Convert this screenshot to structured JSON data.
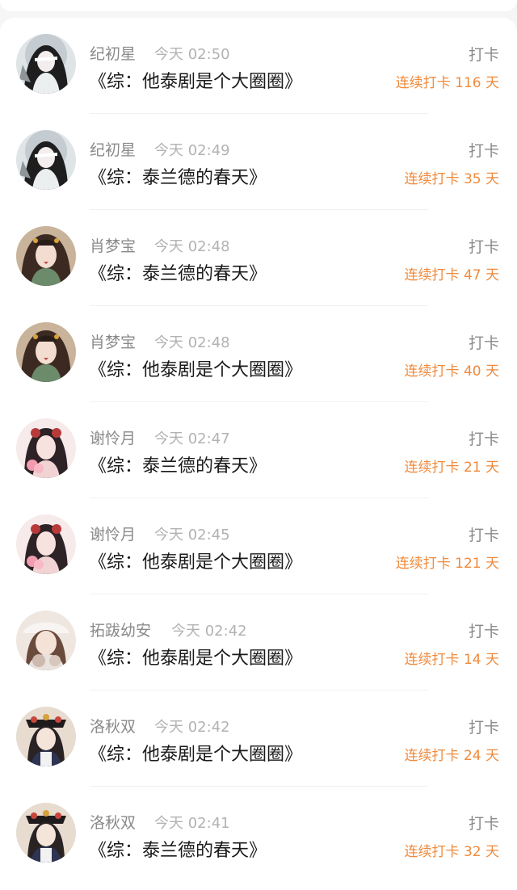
{
  "checkins": [
    {
      "user": "纪初星",
      "time": "今天 02:50",
      "book": "《综：他泰剧是个大圈圈》",
      "action": "打卡",
      "streak": "连续打卡 116 天",
      "avatar": "avatar-ghost-girl"
    },
    {
      "user": "纪初星",
      "time": "今天 02:49",
      "book": "《综：泰兰德的春天》",
      "action": "打卡",
      "streak": "连续打卡 35 天",
      "avatar": "avatar-ghost-girl"
    },
    {
      "user": "肖梦宝",
      "time": "今天 02:48",
      "book": "《综：泰兰德的春天》",
      "action": "打卡",
      "streak": "连续打卡 47 天",
      "avatar": "avatar-ancient-lady"
    },
    {
      "user": "肖梦宝",
      "time": "今天 02:48",
      "book": "《综：他泰剧是个大圈圈》",
      "action": "打卡",
      "streak": "连续打卡 40 天",
      "avatar": "avatar-ancient-lady"
    },
    {
      "user": "谢怜月",
      "time": "今天 02:47",
      "book": "《综：泰兰德的春天》",
      "action": "打卡",
      "streak": "连续打卡 21 天",
      "avatar": "avatar-pink-lady"
    },
    {
      "user": "谢怜月",
      "time": "今天 02:45",
      "book": "《综：他泰剧是个大圈圈》",
      "action": "打卡",
      "streak": "连续打卡 121 天",
      "avatar": "avatar-pink-lady"
    },
    {
      "user": "拓跋幼安",
      "time": "今天 02:42",
      "book": "《综：他泰剧是个大圈圈》",
      "action": "打卡",
      "streak": "连续打卡 14 天",
      "avatar": "avatar-cat-girl"
    },
    {
      "user": "洛秋双",
      "time": "今天 02:42",
      "book": "《综：他泰剧是个大圈圈》",
      "action": "打卡",
      "streak": "连续打卡 24 天",
      "avatar": "avatar-qing-lady"
    },
    {
      "user": "洛秋双",
      "time": "今天 02:41",
      "book": "《综：泰兰德的春天》",
      "action": "打卡",
      "streak": "连续打卡 32 天",
      "avatar": "avatar-qing-lady"
    }
  ],
  "colors": {
    "streak": "#f08a3c",
    "muted": "#8a8a8a",
    "time": "#b2b2b2",
    "title": "#1a1a1a",
    "card": "#ffffff",
    "background": "#f6f6f6"
  }
}
